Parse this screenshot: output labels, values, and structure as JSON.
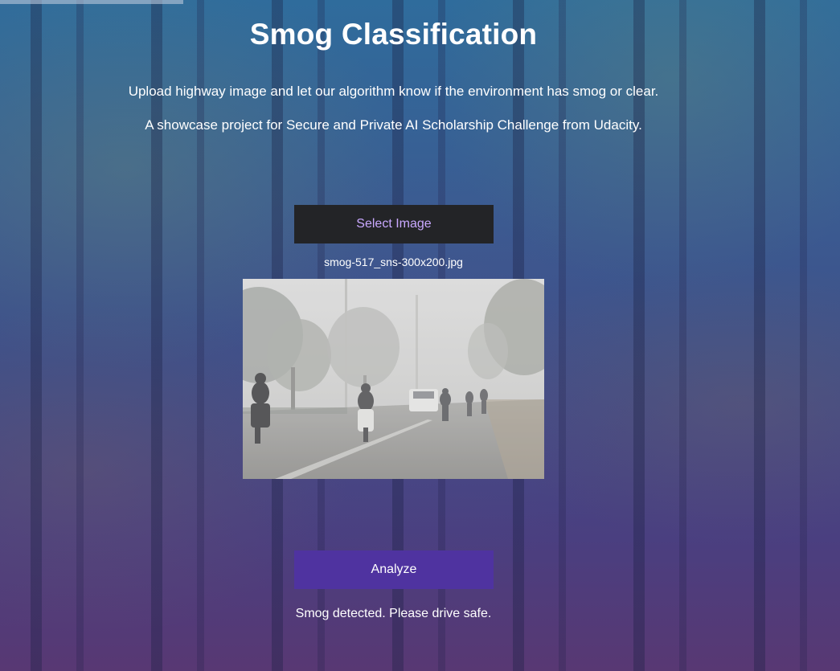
{
  "page": {
    "title": "Smog Classification",
    "description_line1": "Upload highway image and let our algorithm know if the environment has smog or clear.",
    "description_line2": "A showcase project for Secure and Private AI Scholarship Challenge from Udacity."
  },
  "upload": {
    "select_label": "Select Image",
    "file_name": "smog-517_sns-300x200.jpg"
  },
  "analysis": {
    "analyze_label": "Analyze",
    "result_text": "Smog detected. Please drive safe."
  },
  "colors": {
    "select_button_bg": "#232427",
    "select_button_text": "#c9a8ff",
    "analyze_button_bg": "#4f33a0",
    "text": "#ffffff"
  }
}
